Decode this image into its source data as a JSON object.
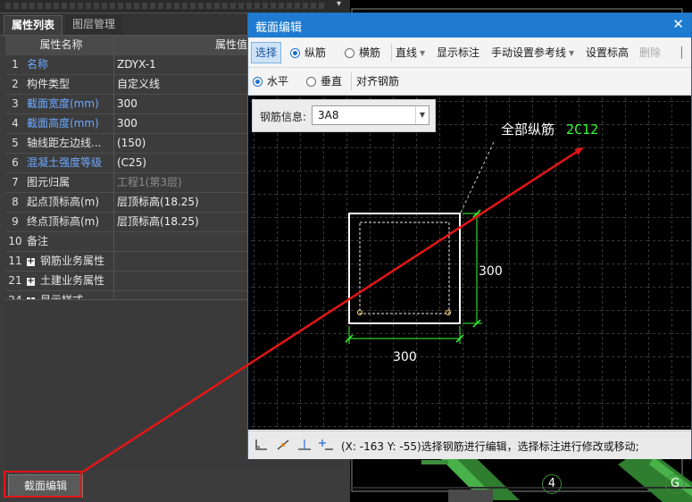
{
  "panel": {
    "tabs": [
      {
        "label": "属性列表",
        "active": true
      },
      {
        "label": "图层管理",
        "active": false
      }
    ],
    "header": {
      "name": "属性名称",
      "value": "属性值"
    },
    "rows": [
      {
        "num": "1",
        "name": "名称",
        "value": "ZDYX-1",
        "blue": true
      },
      {
        "num": "2",
        "name": "构件类型",
        "value": "自定义线"
      },
      {
        "num": "3",
        "name": "截面宽度(mm)",
        "value": "300",
        "blue": true
      },
      {
        "num": "4",
        "name": "截面高度(mm)",
        "value": "300",
        "blue": true
      },
      {
        "num": "5",
        "name": "轴线距左边线...",
        "value": "(150)"
      },
      {
        "num": "6",
        "name": "混凝土强度等级",
        "value": "(C25)",
        "blue": true
      },
      {
        "num": "7",
        "name": "图元归属",
        "value": "工程1(第3层)",
        "grayValue": true
      },
      {
        "num": "8",
        "name": "起点顶标高(m)",
        "value": "层顶标高(18.25)"
      },
      {
        "num": "9",
        "name": "终点顶标高(m)",
        "value": "层顶标高(18.25)"
      },
      {
        "num": "10",
        "name": "备注",
        "value": ""
      },
      {
        "num": "11",
        "name": "钢筋业务属性",
        "value": "",
        "expandable": true
      },
      {
        "num": "21",
        "name": "土建业务属性",
        "value": "",
        "expandable": true
      },
      {
        "num": "24",
        "name": "显示样式",
        "value": "",
        "expandable": true
      }
    ],
    "section_edit_button": "截面编辑"
  },
  "dialog": {
    "title": "截面编辑",
    "toolbar1": {
      "select": "选择",
      "longitudinal": "纵筋",
      "transverse": "横筋",
      "line": "直线",
      "show_annotation": "显示标注",
      "manual_ref_line": "手动设置参考线",
      "set_elevation": "设置标高",
      "delete": "删除"
    },
    "toolbar2": {
      "horizontal": "水平",
      "vertical": "垂直",
      "align_rebar": "对齐钢筋"
    },
    "rebar_info": {
      "label": "钢筋信息:",
      "value": "3A8"
    },
    "canvas": {
      "all_longitudinal_label": "全部纵筋",
      "all_longitudinal_value": "2C12",
      "width_dim": "300",
      "height_dim": "300"
    },
    "status": "(X: -163 Y: -55)选择钢筋进行编辑，选择标注进行修改或移动;"
  },
  "background": {
    "axis_labels": [
      "4",
      "G"
    ]
  },
  "colors": {
    "dialog_title_bg": "#1f7bd0",
    "annotation_green": "#33ff33",
    "highlight_red": "#e51515",
    "blue_property": "#6ea8ff"
  }
}
